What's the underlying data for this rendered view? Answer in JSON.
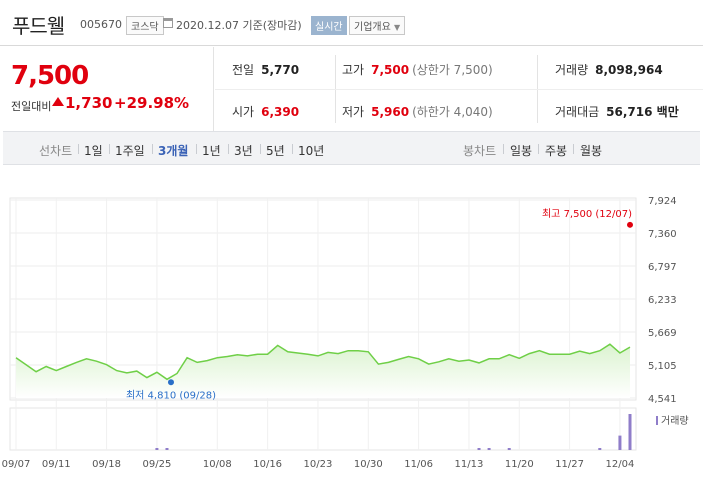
{
  "header": {
    "name": "푸드웰",
    "code": "005670",
    "market": "코스닥",
    "date": "2020.12.07 기준(장마감)",
    "realtime": "실시간",
    "corp_info": "기업개요"
  },
  "price": {
    "current": "7,500",
    "change_label": "전일대비",
    "change": "1,730",
    "change_pct": "+29.98%",
    "color_up": "#e0000e"
  },
  "stats": {
    "prev_close_label": "전일",
    "prev_close": "5,770",
    "high_label": "고가",
    "high": "7,500",
    "upper_limit": "(상한가 7,500)",
    "volume_label": "거래량",
    "volume": "8,098,964",
    "open_label": "시가",
    "open": "6,390",
    "low_label": "저가",
    "low": "5,960",
    "lower_limit": "(하한가 4,040)",
    "amount_label": "거래대금",
    "amount": "56,716 백만"
  },
  "tabs": {
    "line_label": "선차트",
    "line_periods": [
      "1일",
      "1주일",
      "3개월",
      "1년",
      "3년",
      "5년",
      "10년"
    ],
    "active": "3개월",
    "candle_label": "봉차트",
    "candle_periods": [
      "일봉",
      "주봉",
      "월봉"
    ]
  },
  "chart_data": {
    "type": "line",
    "x": [
      "09/07",
      "09/08",
      "09/09",
      "09/10",
      "09/11",
      "09/14",
      "09/15",
      "09/16",
      "09/17",
      "09/18",
      "09/21",
      "09/22",
      "09/23",
      "09/24",
      "09/25",
      "09/28",
      "09/29",
      "10/05",
      "10/06",
      "10/07",
      "10/08",
      "10/12",
      "10/13",
      "10/14",
      "10/15",
      "10/16",
      "10/19",
      "10/20",
      "10/21",
      "10/22",
      "10/23",
      "10/26",
      "10/27",
      "10/28",
      "10/29",
      "10/30",
      "11/02",
      "11/03",
      "11/04",
      "11/05",
      "11/06",
      "11/09",
      "11/10",
      "11/11",
      "11/12",
      "11/13",
      "11/16",
      "11/17",
      "11/18",
      "11/19",
      "11/20",
      "11/23",
      "11/24",
      "11/25",
      "11/26",
      "11/27",
      "11/30",
      "12/01",
      "12/02",
      "12/03",
      "12/04",
      "12/07"
    ],
    "y": [
      5230,
      5110,
      4990,
      5080,
      5010,
      5080,
      5150,
      5210,
      5170,
      5110,
      5010,
      4970,
      5000,
      4890,
      4980,
      4860,
      4960,
      5230,
      5150,
      5180,
      5230,
      5250,
      5280,
      5260,
      5290,
      5290,
      5440,
      5330,
      5310,
      5290,
      5260,
      5320,
      5300,
      5350,
      5350,
      5330,
      5120,
      5150,
      5200,
      5250,
      5210,
      5120,
      5160,
      5210,
      5170,
      5190,
      5140,
      5210,
      5210,
      5280,
      5220,
      5300,
      5350,
      5290,
      5290,
      5290,
      5340,
      5300,
      5350,
      5460,
      5310,
      5410
    ],
    "y_ticks": [
      "7,924",
      "7,360",
      "6,797",
      "6,233",
      "5,669",
      "5,105",
      "4,541"
    ],
    "ylim": [
      4541,
      7924
    ],
    "x_ticks": [
      "09/07",
      "09/11",
      "09/18",
      "09/25",
      "10/08",
      "10/16",
      "10/23",
      "10/30",
      "11/06",
      "11/13",
      "11/20",
      "11/27",
      "12/04"
    ],
    "max_label": "최고 7,500 (12/07)",
    "min_label": "최저 4,810 (09/28)",
    "volume_label": "거래량",
    "volume": [
      0,
      0,
      0,
      0,
      0,
      0,
      0,
      0,
      0,
      0,
      0,
      0,
      0,
      0,
      0.02,
      0.02,
      0,
      0,
      0,
      0,
      0,
      0,
      0,
      0,
      0,
      0,
      0,
      0,
      0,
      0,
      0,
      0,
      0,
      0,
      0,
      0,
      0,
      0,
      0,
      0,
      0,
      0,
      0,
      0,
      0,
      0,
      0.02,
      0.02,
      0,
      0.02,
      0,
      0,
      0,
      0,
      0,
      0,
      0,
      0,
      0.02,
      0,
      0.4,
      1
    ],
    "colors": {
      "line": "#6fcf47",
      "area_top": "#dbf3d0",
      "max": "#e0000e",
      "min": "#2a6fc8",
      "volume": "#8f7dc9"
    }
  }
}
